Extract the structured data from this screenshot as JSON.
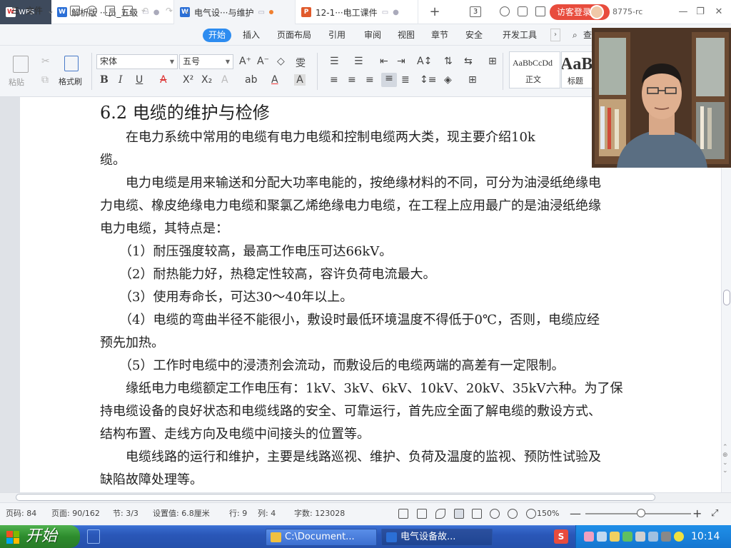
{
  "tabs": {
    "wps": "WPS",
    "items": [
      {
        "label": "解析版 ···员_五级"
      },
      {
        "label": "电气设···与维护"
      },
      {
        "label": "12-1···电工课件"
      }
    ],
    "window_count": "3",
    "login": "访客登录",
    "user_id": "8775-rc"
  },
  "menu": {
    "file": "文件",
    "items": [
      "开始",
      "插入",
      "页面布局",
      "引用",
      "审阅",
      "视图",
      "章节",
      "安全",
      "开发工具"
    ],
    "search": "查"
  },
  "toolbar": {
    "paste": "粘贴",
    "format_painter": "格式刷",
    "font_name": "宋体",
    "font_size": "五号",
    "style_sample": "AaBbCcDd",
    "style_normal": "正文",
    "style_heading_sample": "AaB",
    "style_heading": "标题"
  },
  "document": {
    "heading": "6.2  电缆的维护与检修",
    "lines": [
      "　　在电力系统中常用的电缆有电力电缆和控制电缆两大类，现主要介绍10k",
      "缆。",
      "　　电力电缆是用来输送和分配大功率电能的，按绝缘材料的不同，可分为油浸纸绝缘电",
      "力电缆、橡皮绝缘电力电缆和聚氯乙烯绝缘电力电缆，在工程上应用最广的是油浸纸绝缘",
      "电力电缆，其特点是：",
      "　　（1）耐压强度较高，最高工作电压可达66kV。",
      "　　（2）耐热能力好，热稳定性较高，容许负荷电流最大。",
      "　　（3）使用寿命长，可达30～40年以上。",
      "　　（4）电缆的弯曲半径不能很小，敷设时最低环境温度不得低于0℃，否则，电缆应经",
      "预先加热。",
      "　　（5）工作时电缆中的浸渍剂会流动，而敷设后的电缆两端的高差有一定限制。",
      "　　缘纸电力电缆额定工作电压有：1kV、3kV、6kV、10kV、20kV、35kV六种。为了保",
      "持电缆设备的良好状态和电缆线路的安全、可靠运行，首先应全面了解电缆的敷设方式、",
      "结构布置、走线方向及电缆中间接头的位置等。",
      "　　电缆线路的运行和维护，主要是线路巡视、维护、负荷及温度的监视、预防性试验及",
      "缺陷故障处理等。"
    ]
  },
  "status": {
    "page_code": "页码: 84",
    "pages": "页面: 90/162",
    "section": "节: 3/3",
    "setting": "设置值: 6.8厘米",
    "row": "行: 9",
    "col": "列: 4",
    "words": "字数: 123028",
    "zoom": "150%"
  },
  "taskbar": {
    "start": "开始",
    "tasks": [
      "C:\\Document...",
      "电气设备故..."
    ],
    "clock": "10:14"
  },
  "colors": {
    "accent": "#2d8cf0",
    "login": "#e84c3d",
    "taskbar": "#2a57b8",
    "start": "#2d8c2d"
  }
}
